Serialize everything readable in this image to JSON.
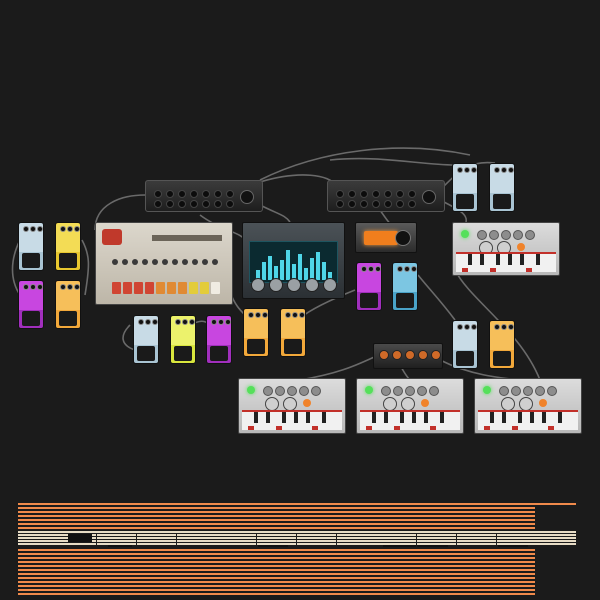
{
  "canvas": {
    "background": "#1b1b1b",
    "cable_color": "#6a6a6a"
  },
  "devices": {
    "mixers": [
      "mixer",
      "mixer"
    ],
    "pedal_colors": {
      "white": "#a9c4d3",
      "yellow": "#e8c72f",
      "magenta": "#a12fbd",
      "orange": "#f2a83a",
      "cyan": "#4aa3c8",
      "lime": "#d9e63d"
    },
    "drum_machine": "drum-machine",
    "synth": "synth",
    "amp": "amp",
    "bass_synths": [
      "bass-synth",
      "bass-synth",
      "bass-synth",
      "bass-synth"
    ],
    "multi_unit": "multi-knob-unit"
  },
  "sequencer": {
    "lane_colors": [
      "#f08a4b",
      "#e7dcc5"
    ]
  }
}
